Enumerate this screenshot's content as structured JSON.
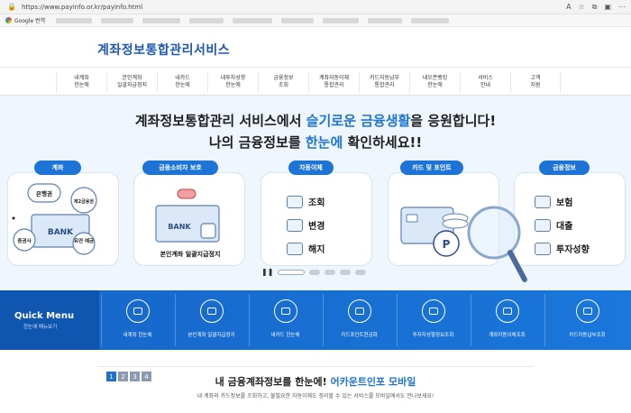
{
  "browser": {
    "url": "https://www.payinfo.or.kr/payinfo.html",
    "bookmark_first": "Google 번역",
    "icons": [
      "reader-icon",
      "star-icon",
      "extensions-icon",
      "collections-icon",
      "more-icon"
    ]
  },
  "header": {
    "title": "계좌정보통합관리서비스"
  },
  "nav": {
    "items": [
      {
        "label": "내계좌\n한눈에"
      },
      {
        "label": "본인계좌\n일괄지급정지"
      },
      {
        "label": "내카드\n한눈에"
      },
      {
        "label": "내투자성향\n한눈에"
      },
      {
        "label": "금융정보\n조회"
      },
      {
        "label": "계좌자동이체\n통합관리"
      },
      {
        "label": "카드자동납부\n통합관리"
      },
      {
        "label": "내오픈뱅킹\n한눈에"
      },
      {
        "label": "서비스\n안내"
      },
      {
        "label": "고객\n지원"
      }
    ]
  },
  "hero": {
    "line1_pre": "계좌정보통합관리 서비스에서 ",
    "line1_hi": "슬기로운 금융생활",
    "line1_post": "을 응원합니다!",
    "line2_pre": "나의 금융정보를 ",
    "line2_hi": "한눈에",
    "line2_post": " 확인하세요!!",
    "cards": [
      {
        "tag": "계좌",
        "labels": [
          "은행권",
          "제2금융권",
          "BANK",
          "증권사",
          "유연\n예금"
        ]
      },
      {
        "tag": "금융소비자 보호",
        "labels": [
          "BANK",
          "본인계좌 일괄지급정지"
        ]
      },
      {
        "tag": "자동이체",
        "items": [
          "조회",
          "변경",
          "해지"
        ]
      },
      {
        "tag": "카드 및 포인트",
        "labels": [
          "P"
        ]
      },
      {
        "tag": "금융정보",
        "items": [
          "보험",
          "대출",
          "투자성향"
        ]
      }
    ],
    "slider": {
      "pause_label": "❚❚",
      "active_index": 0,
      "count": 5
    }
  },
  "quick": {
    "title": "Quick Menu",
    "subtitle": "한눈에 메뉴보기",
    "items": [
      {
        "label": "내계좌 한눈에",
        "icon": "bank-icon"
      },
      {
        "label": "본인계좌 일괄지급정지",
        "icon": "card-stop-icon"
      },
      {
        "label": "내카드 한눈에",
        "icon": "card-icon"
      },
      {
        "label": "카드포인트현금화",
        "icon": "point-icon"
      },
      {
        "label": "투자자성향정보조회",
        "icon": "chart-icon"
      },
      {
        "label": "계좌자동이체조회",
        "icon": "transfer-icon"
      },
      {
        "label": "카드자동납부조회",
        "icon": "autopay-icon"
      }
    ]
  },
  "bottom": {
    "pages": [
      "1",
      "2",
      "3",
      "4"
    ],
    "active_page": 0,
    "title_pre": "내 금융계좌정보를 한눈에! ",
    "title_hi": "어카운트인포 모바일",
    "subtitle": "내 계좌와 카드정보를 조회하고, 불필요한 자동이체도 정리할 수 있는 서비스를 모바일에서도 만나보세요!"
  },
  "colors": {
    "primary": "#1d74d6",
    "quick_bg": "#1666c8",
    "hero_bg": "#f0f6fd",
    "title": "#1d57b5"
  }
}
